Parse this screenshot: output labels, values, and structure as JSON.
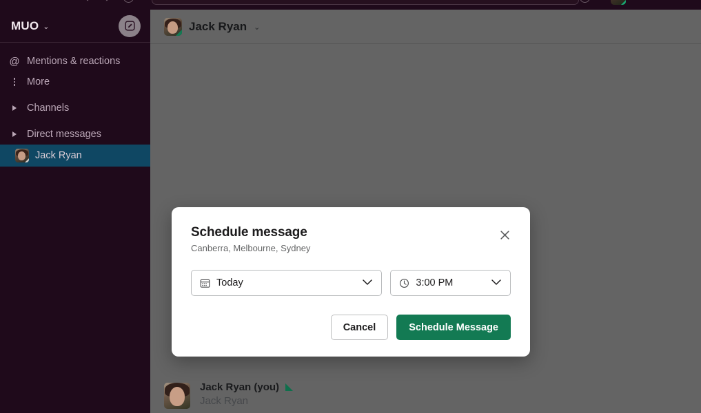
{
  "topbar": {
    "history_back_icon": "chevron-left-icon",
    "history_forward_icon": "chevron-right-icon",
    "clock_icon": "history-clock-icon",
    "search_placeholder": "",
    "help_icon": "help-circle-icon",
    "avatar_icon": "user-avatar"
  },
  "sidebar": {
    "workspace_name": "MUO",
    "workspace_caret": "⌄",
    "compose_icon": "compose-pencil-icon",
    "items": [
      {
        "label": "Mentions & reactions",
        "icon": "at-sign-icon",
        "type": "nav"
      },
      {
        "label": "More",
        "icon": "more-vertical-dots-icon",
        "type": "nav"
      },
      {
        "label": "Channels",
        "icon": "disclosure-triangle-icon",
        "type": "section"
      },
      {
        "label": "Direct messages",
        "icon": "disclosure-triangle-icon",
        "type": "section"
      }
    ],
    "dm": {
      "label": "Jack Ryan",
      "avatar_icon": "user-avatar",
      "presence": "away",
      "active": "true"
    }
  },
  "channel_header": {
    "title": "Jack Ryan",
    "caret": "⌄",
    "avatar_icon": "user-avatar",
    "presence_color": "#137a54"
  },
  "message": {
    "author": "Jack Ryan (you)",
    "body": "Jack Ryan",
    "flag_icon": "green-corner-flag-icon",
    "avatar_icon": "user-avatar"
  },
  "modal": {
    "title": "Schedule message",
    "subtitle": "Canberra, Melbourne, Sydney",
    "close_icon": "close-x-icon",
    "date_select": {
      "value": "Today",
      "icon": "calendar-icon",
      "chevron": "chevron-down-icon"
    },
    "time_select": {
      "value": "3:00 PM",
      "icon": "clock-icon",
      "chevron": "chevron-down-icon"
    },
    "cancel_label": "Cancel",
    "submit_label": "Schedule Message"
  },
  "colors": {
    "sidebar_bg": "#1f0a1b",
    "sidebar_active": "#0f4763",
    "overlay_gray": "#646464",
    "primary_green": "#137a53",
    "modal_bg": "#ffffff"
  }
}
